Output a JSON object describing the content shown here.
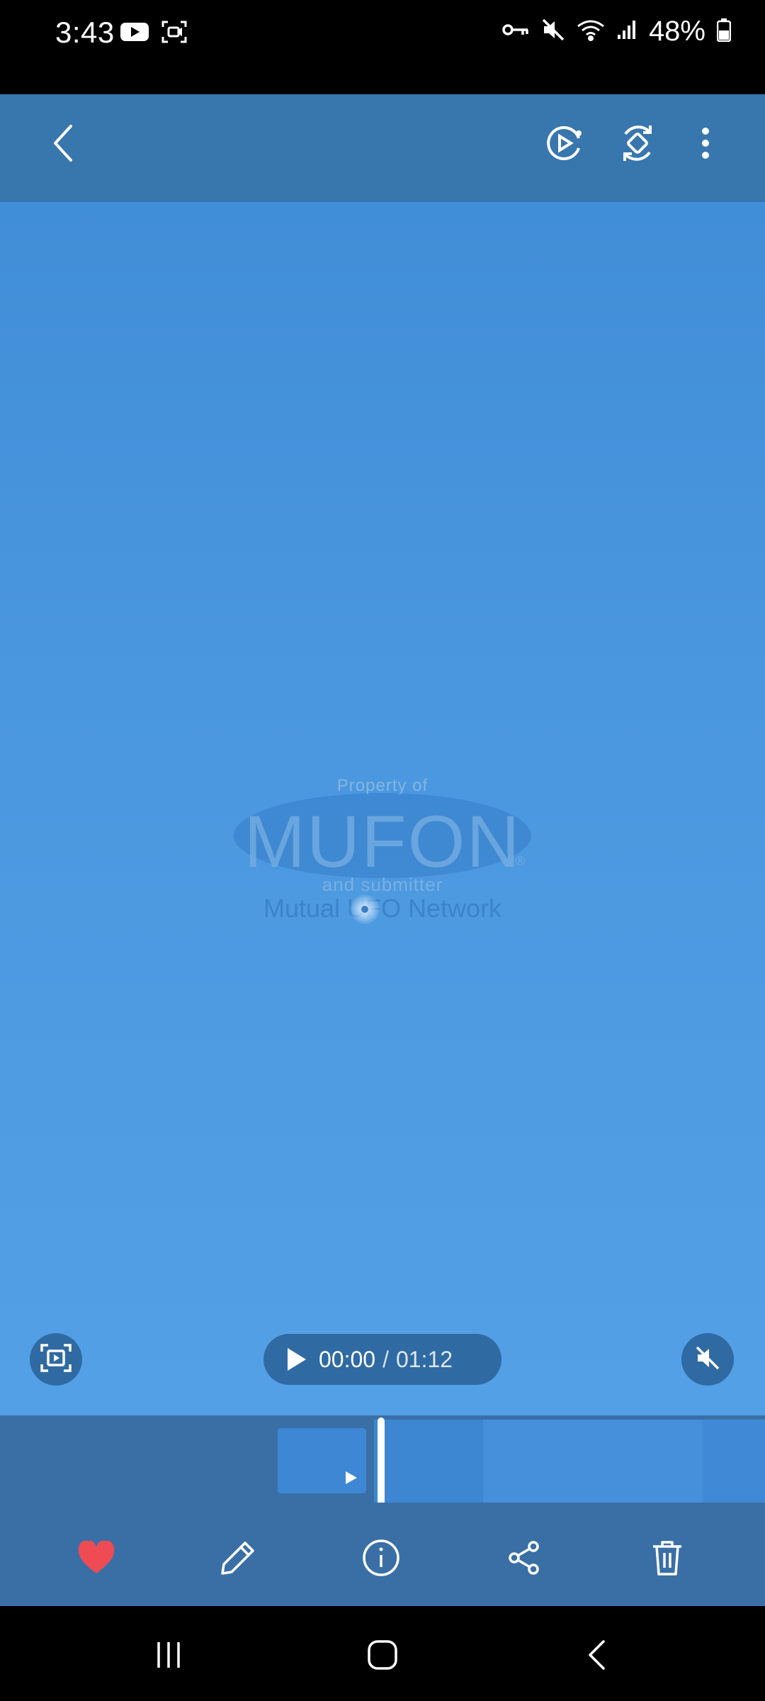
{
  "status_bar": {
    "time": "3:43",
    "battery": "48%",
    "left_icons": [
      "youtube-icon",
      "screen-record-icon"
    ],
    "right_icons": [
      "vpn-key-icon",
      "mute-icon",
      "wifi-icon",
      "signal-icon",
      "battery-icon"
    ]
  },
  "top_bar": {
    "icons": [
      "back-arrow-icon",
      "play-circle-icon",
      "auto-rotate-icon",
      "more-options-icon"
    ]
  },
  "watermark": {
    "line1": "Property of",
    "main": "MUFON",
    "reg": "®",
    "line2": "and submitter",
    "line3": "Mutual UFO Network"
  },
  "player": {
    "current_time": "00:00",
    "separator": "/",
    "total_time": "01:12",
    "icons": [
      "capture-frame-icon",
      "play-icon",
      "mute-icon"
    ]
  },
  "bottom_actions": {
    "icons": [
      "favorite-heart-icon",
      "edit-pencil-icon",
      "info-icon",
      "share-icon",
      "delete-trash-icon"
    ],
    "heart_color": "#ee4b55"
  },
  "nav_bar": {
    "icons": [
      "recents-icon",
      "home-icon",
      "back-icon"
    ]
  },
  "colors": {
    "topbar": "#3876ae",
    "video_bg": "#4a97df",
    "controls": "#2f6aa3"
  }
}
